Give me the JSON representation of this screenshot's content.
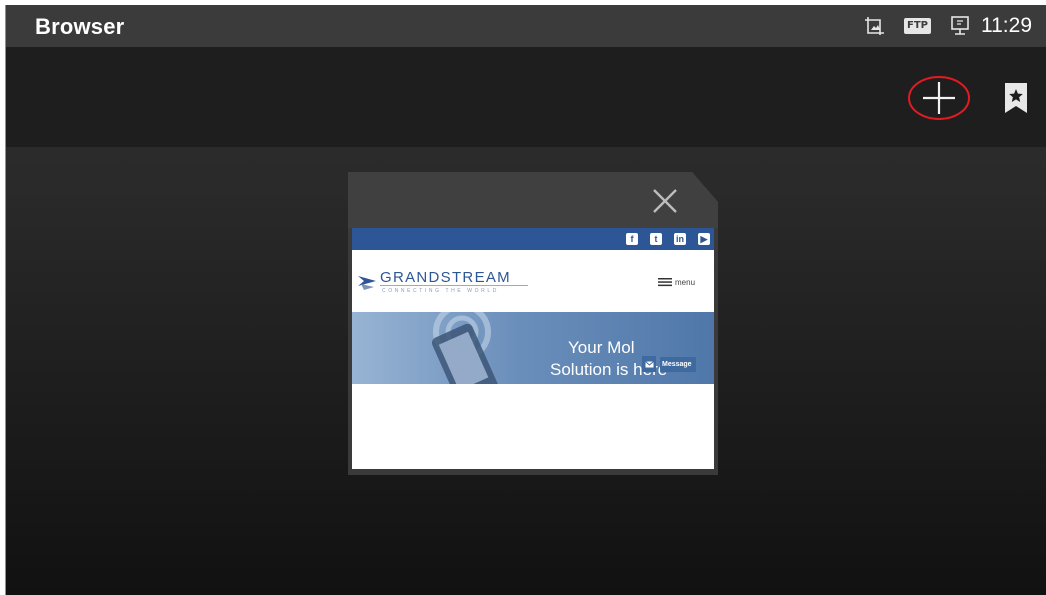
{
  "status_bar": {
    "app_title": "Browser",
    "ftp_label": "FTP",
    "time": "11:29"
  },
  "action_bar": {
    "icons": [
      "plus-icon",
      "bookmark-star-icon"
    ],
    "highlight_color": "#e11b22"
  },
  "tab": {
    "close_icon": "close-icon",
    "thumbnail": {
      "social_icons": [
        "facebook-icon",
        "twitter-icon",
        "linkedin-icon",
        "youtube-icon"
      ],
      "brand_name": "GRANDSTREAM",
      "brand_tagline": "CONNECTING THE WORLD",
      "menu_label": "menu",
      "hero_line1": "Your Mol",
      "hero_line2": "Solution is here",
      "message_button": "Message",
      "brand_color": "#2d5696"
    }
  }
}
